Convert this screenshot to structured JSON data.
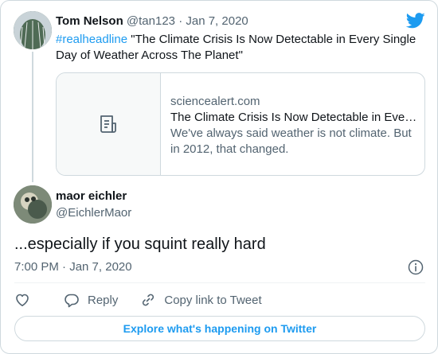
{
  "quoted_tweet": {
    "name": "Tom Nelson",
    "handle": "@tan123",
    "separator": "·",
    "date": "Jan 7, 2020",
    "hashtag": "#realheadline",
    "text": " \"The Climate Crisis Is Now Detectable in Every Single Day of Weather Across The Planet\"",
    "link_card": {
      "domain": "sciencealert.com",
      "title": "The Climate Crisis Is Now Detectable in Every Single Day of Weather Across The Planet",
      "description": "We've always said weather is not climate. But in 2012, that changed."
    }
  },
  "tweet": {
    "name": "maor eichler",
    "handle": "@EichlerMaor",
    "text": "...especially if you squint really hard",
    "timestamp": "7:00 PM · Jan 7, 2020"
  },
  "actions": {
    "reply": "Reply",
    "copy_link": "Copy link to Tweet"
  },
  "explore_label": "Explore what's happening on Twitter",
  "colors": {
    "accent": "#1d9bf0",
    "secondary_text": "#536471",
    "border": "#cfd9de"
  },
  "icons": [
    "twitter-bird-icon",
    "document-icon",
    "info-icon",
    "heart-icon",
    "reply-icon",
    "link-icon"
  ]
}
